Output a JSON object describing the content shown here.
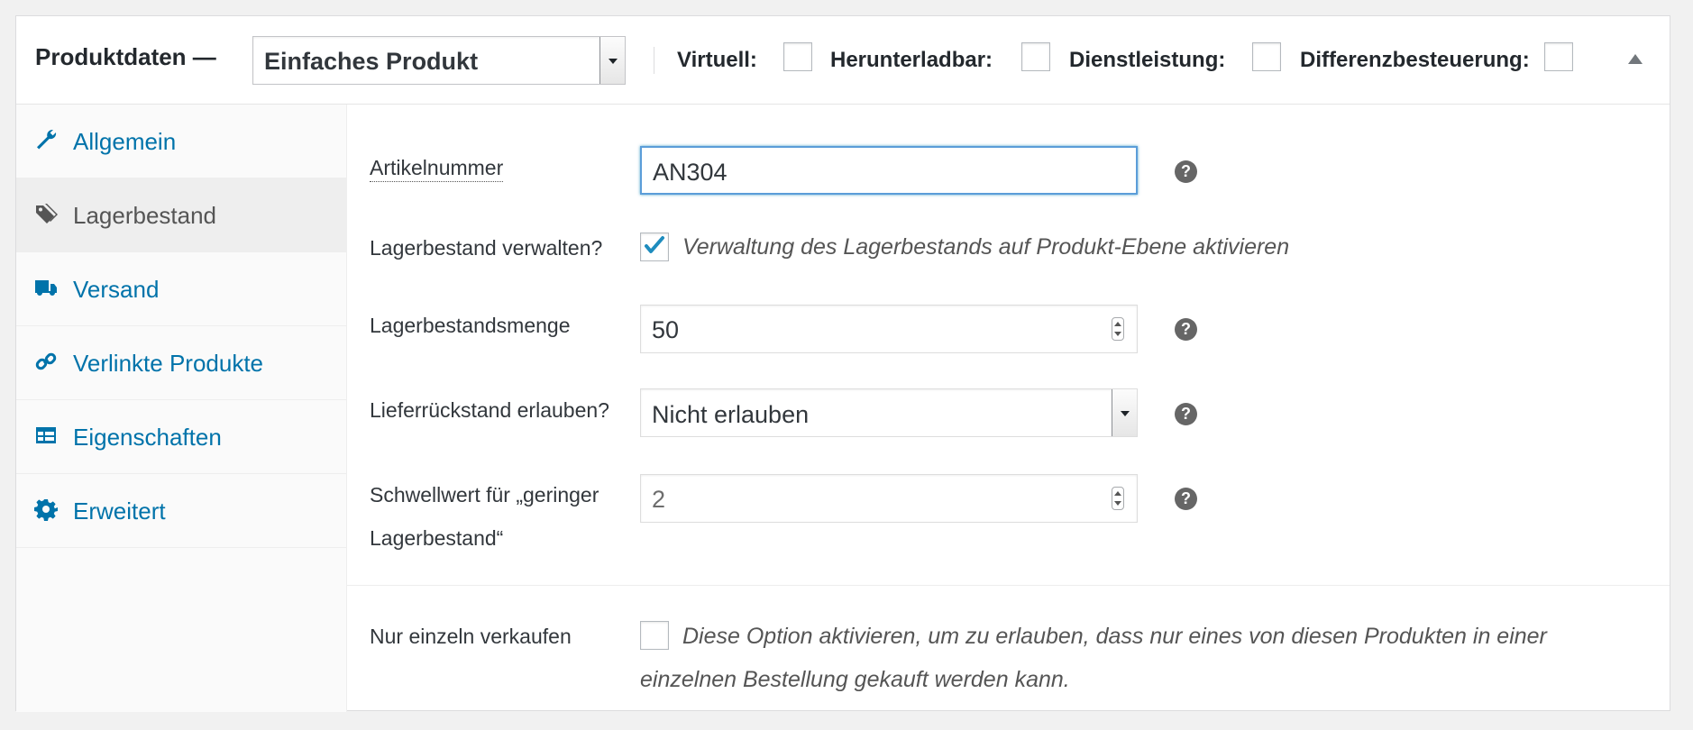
{
  "header": {
    "title": "Produktdaten —",
    "product_type": "Einfaches Produkt",
    "flags": [
      {
        "label": "Virtuell:",
        "checked": false
      },
      {
        "label": "Herunterladbar:",
        "checked": false
      },
      {
        "label": "Dienstleistung:",
        "checked": false
      },
      {
        "label": "Differenzbesteuerung:",
        "checked": false
      }
    ],
    "collapse_icon": "triangle-up-icon"
  },
  "sidebar": {
    "items": [
      {
        "label": "Allgemein",
        "icon": "wrench-icon",
        "active": false
      },
      {
        "label": "Lagerbestand",
        "icon": "tag-icon",
        "active": true
      },
      {
        "label": "Versand",
        "icon": "truck-icon",
        "active": false
      },
      {
        "label": "Verlinkte Produkte",
        "icon": "link-icon",
        "active": false
      },
      {
        "label": "Eigenschaften",
        "icon": "table-icon",
        "active": false
      },
      {
        "label": "Erweitert",
        "icon": "gear-icon",
        "active": false
      }
    ]
  },
  "form": {
    "sku": {
      "label": "Artikelnummer",
      "value": "AN304",
      "help": "?"
    },
    "manage_stock": {
      "label": "Lagerbestand verwalten?",
      "checked": true,
      "description": "Verwaltung des Lagerbestands auf Produkt-Ebene aktivieren"
    },
    "stock_qty": {
      "label": "Lagerbestandsmenge",
      "value": "50",
      "help": "?"
    },
    "backorders": {
      "label": "Lieferrückstand erlauben?",
      "value": "Nicht erlauben",
      "help": "?"
    },
    "low_stock": {
      "label_line1": "Schwellwert für „geringer",
      "label_line2": "Lagerbestand“",
      "value": "2",
      "help": "?"
    },
    "sold_individually": {
      "label": "Nur einzeln verkaufen",
      "checked": false,
      "description_line1": "Diese Option aktivieren, um zu erlauben, dass nur eines von diesen Produkten in einer",
      "description_line2": "einzelnen Bestellung gekauft werden kann."
    }
  },
  "colors": {
    "accent": "#0073aa",
    "focus": "#5b9dd9",
    "active_tab_bg": "#eeeeee"
  }
}
